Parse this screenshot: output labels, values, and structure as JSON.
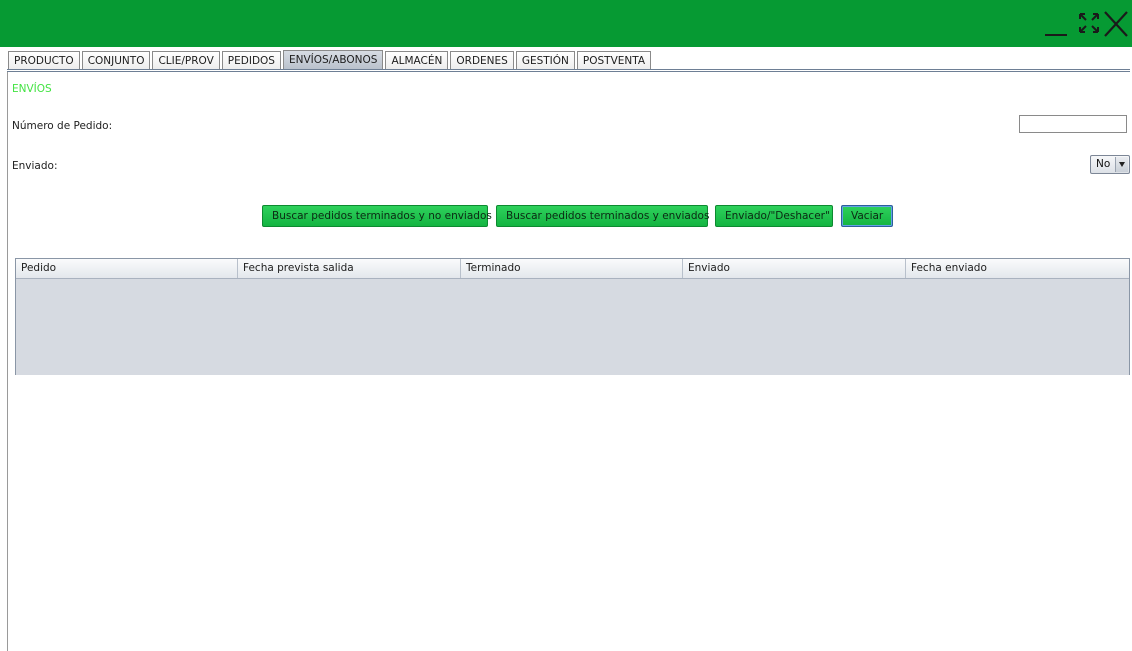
{
  "window": {
    "title_bar_color": "#069a33",
    "controls": {
      "minimize_icon": "minimize-icon",
      "maximize_icon": "maximize-icon",
      "close_icon": "close-icon"
    }
  },
  "tabs": [
    {
      "label": "PRODUCTO",
      "active": false
    },
    {
      "label": "CONJUNTO",
      "active": false
    },
    {
      "label": "CLIE/PROV",
      "active": false
    },
    {
      "label": "PEDIDOS",
      "active": false
    },
    {
      "label": "ENVÍOS/ABONOS",
      "active": true
    },
    {
      "label": "ALMACÉN",
      "active": false
    },
    {
      "label": "ORDENES",
      "active": false
    },
    {
      "label": "GESTIÓN",
      "active": false
    },
    {
      "label": "POSTVENTA",
      "active": false
    }
  ],
  "panel": {
    "section_title": "ENVÍOS",
    "section_title_color": "#42e342",
    "numero_pedido": {
      "label": "Número de Pedido:",
      "value": ""
    },
    "enviado": {
      "label": "Enviado:",
      "selected": "No"
    },
    "buttons": {
      "buscar_no_enviados": "Buscar pedidos terminados y no enviados",
      "buscar_enviados": "Buscar pedidos terminados y enviados",
      "enviado_deshacer": "Enviado/\"Deshacer\"",
      "vaciar": "Vaciar"
    },
    "button_color": "#14b441"
  },
  "table": {
    "columns": [
      "Pedido",
      "Fecha prevista salida",
      "Terminado",
      "Enviado",
      "Fecha enviado"
    ],
    "rows": []
  }
}
